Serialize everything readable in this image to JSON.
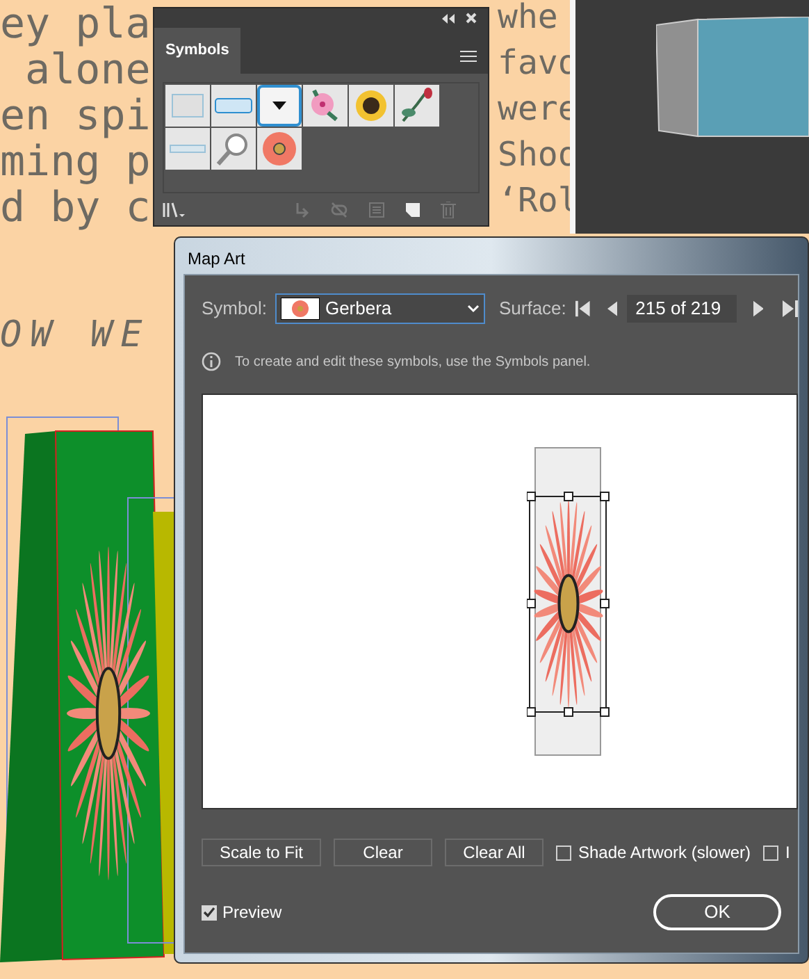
{
  "background_text_left": [
    "ey pla",
    " alone",
    "en spi",
    "ming p",
    "d by c"
  ],
  "background_text_right": [
    "whe",
    "favo",
    "were",
    "Shoo",
    "‘Rol"
  ],
  "background_headline": "OW WE",
  "symbols_panel": {
    "tab": "Symbols",
    "symbols": [
      {
        "kind": "box"
      },
      {
        "kind": "bar"
      },
      {
        "kind": "dropdown"
      },
      {
        "kind": "hibiscus"
      },
      {
        "kind": "sunflower"
      },
      {
        "kind": "rose"
      },
      {
        "kind": "line"
      },
      {
        "kind": "magnifier"
      },
      {
        "kind": "gerbera"
      }
    ]
  },
  "dialog": {
    "title": "Map Art",
    "symbol_label": "Symbol:",
    "symbol_value": "Gerbera",
    "surface_label": "Surface:",
    "surface_value": "215 of 219",
    "info": "To create and edit these symbols, use the Symbols panel.",
    "buttons": [
      "Scale to Fit",
      "Clear",
      "Clear All"
    ],
    "options": [
      {
        "label": "Shade Artwork (slower)",
        "checked": false
      },
      {
        "label": "I",
        "checked": false
      }
    ],
    "preview": {
      "label": "Preview",
      "checked": true
    },
    "ok": "OK"
  }
}
